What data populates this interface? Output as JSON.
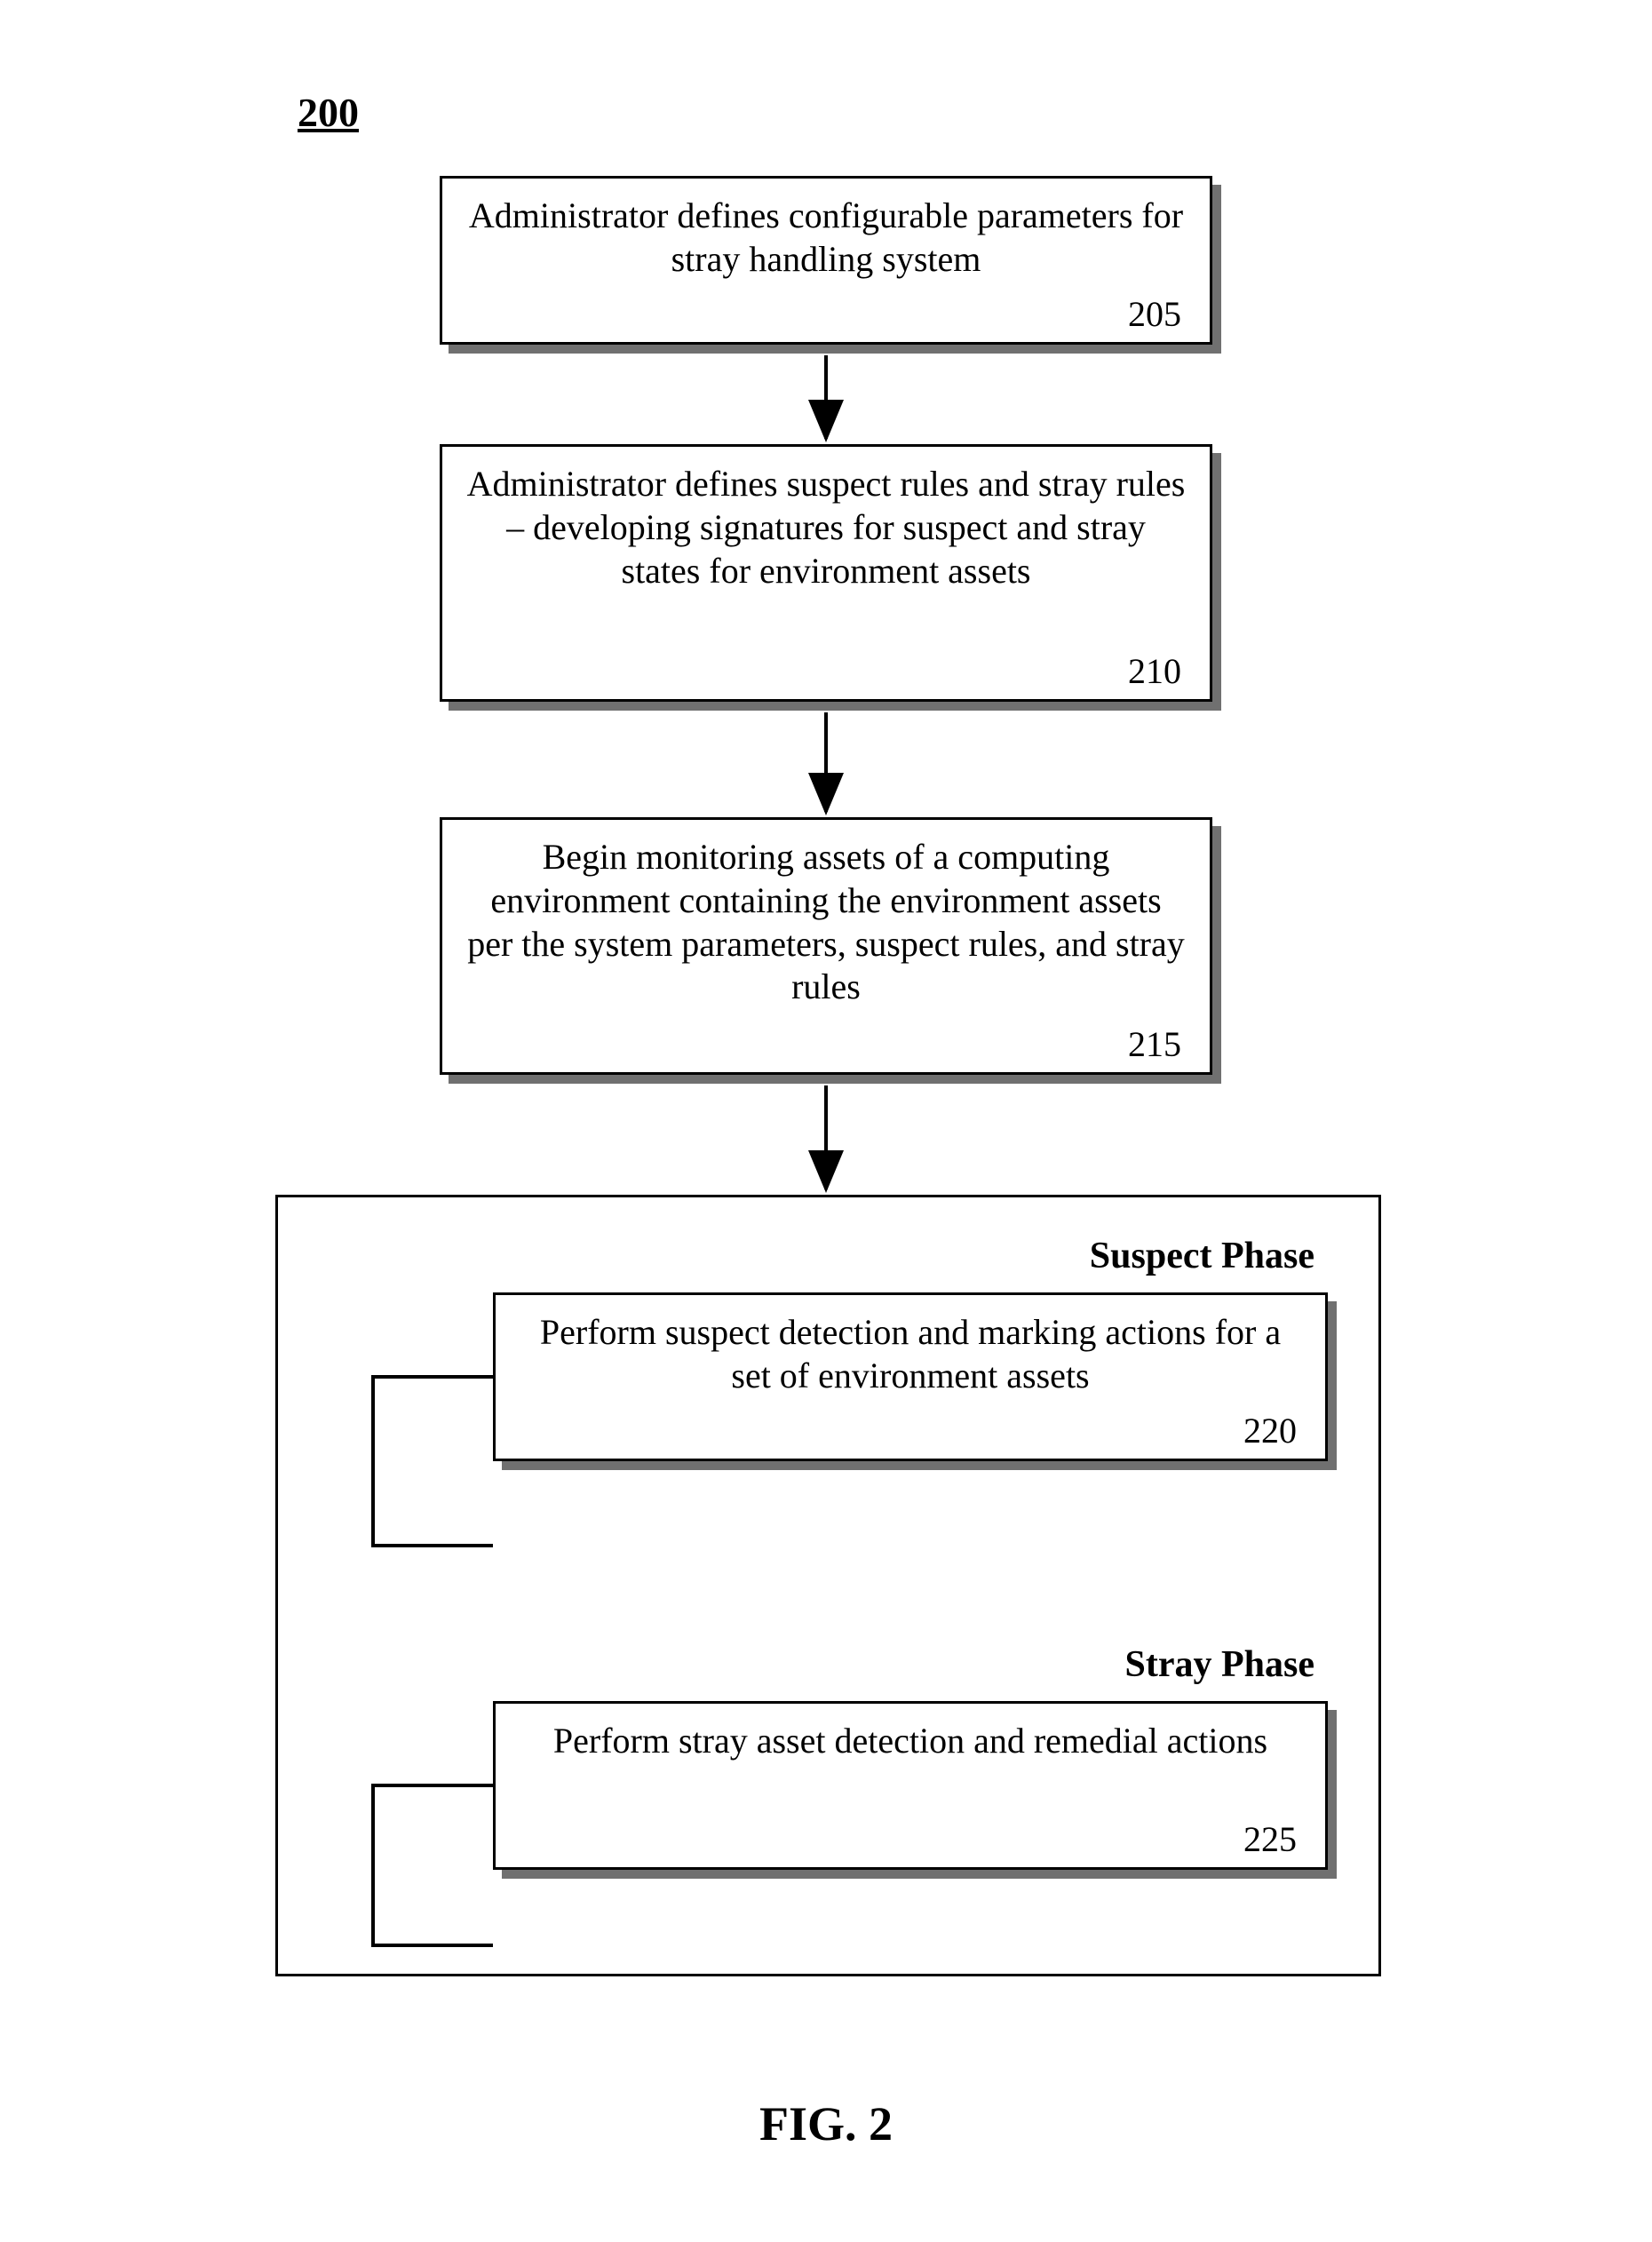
{
  "figure_label": "200",
  "caption": "FIG. 2",
  "boxes": {
    "b205": {
      "text": "Administrator defines configurable parameters for stray handling system",
      "num": "205"
    },
    "b210": {
      "text": "Administrator defines suspect rules and stray rules – developing signatures for suspect and stray states for environment assets",
      "num": "210"
    },
    "b215": {
      "text": "Begin monitoring assets of a computing environment containing the environment assets per the system parameters, suspect rules, and stray rules",
      "num": "215"
    },
    "b220": {
      "text": "Perform suspect detection and marking actions for a set of environment assets",
      "num": "220"
    },
    "b225": {
      "text": "Perform stray asset detection and remedial actions",
      "num": "225"
    }
  },
  "phases": {
    "suspect": "Suspect Phase",
    "stray": "Stray Phase"
  }
}
